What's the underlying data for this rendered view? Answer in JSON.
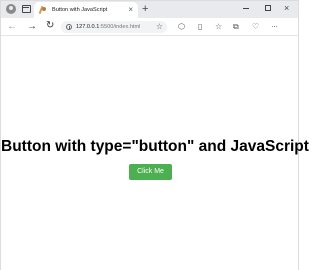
{
  "browser": {
    "tab": {
      "title": "Button with JavaScript",
      "close_glyph": "×"
    },
    "new_tab_glyph": "+",
    "window_controls": {
      "close_glyph": "×"
    },
    "address_bar": {
      "host": "127.0.0.1",
      "path": ":5500/index.html"
    },
    "toolbar_icons": [
      "back-icon",
      "forward-icon",
      "reload-icon",
      "info-icon",
      "favorite-star-icon",
      "extensions-icon",
      "split-screen-icon",
      "favorites-icon",
      "collections-icon",
      "history-icon",
      "more-icon"
    ]
  },
  "page": {
    "heading": "Button with type=\"button\" and JavaScript",
    "button_label": "Click Me",
    "button_color": "#4caf50"
  }
}
